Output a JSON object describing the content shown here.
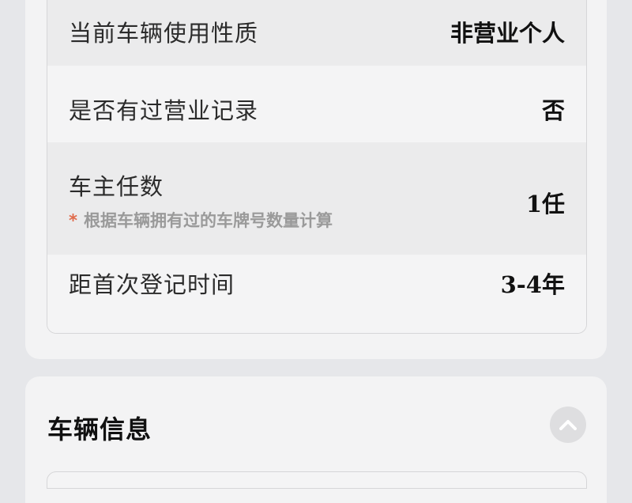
{
  "vehicle_usage": {
    "rows": [
      {
        "label": "当前车辆使用性质",
        "value": "非营业个人"
      },
      {
        "label": "是否有过营业记录",
        "value": "否"
      },
      {
        "label": "车主任数",
        "value": "1任",
        "note_marker": "*",
        "note": "根据车辆拥有过的车牌号数量计算"
      },
      {
        "label": "距首次登记时间",
        "value": "3-4年"
      }
    ]
  },
  "vehicle_info": {
    "title": "车辆信息",
    "toggle_icon": "chevron-up-icon"
  }
}
